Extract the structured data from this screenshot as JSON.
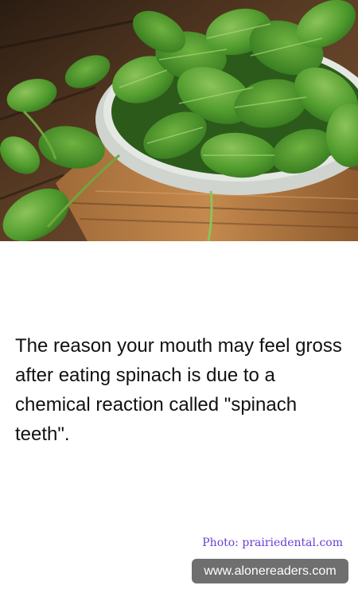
{
  "photo": {
    "subject": "spinach-leaves-bowl",
    "colors": {
      "wood_dark": "#3e2a1a",
      "wood_light": "#b07a45",
      "leaf_dark": "#2f6b1e",
      "leaf_mid": "#4f9a2c",
      "leaf_light": "#8cc35a",
      "bowl_rim": "#d9ddd8"
    }
  },
  "caption": {
    "text": "The reason your mouth may feel gross after eating spinach is due to a chemical reaction called \"spinach teeth\"."
  },
  "credit": {
    "text": "Photo: prairiedental.com",
    "color": "#6a3fd6"
  },
  "site_badge": {
    "text": "www.alonereaders.com",
    "background": "#6f6f6f"
  }
}
